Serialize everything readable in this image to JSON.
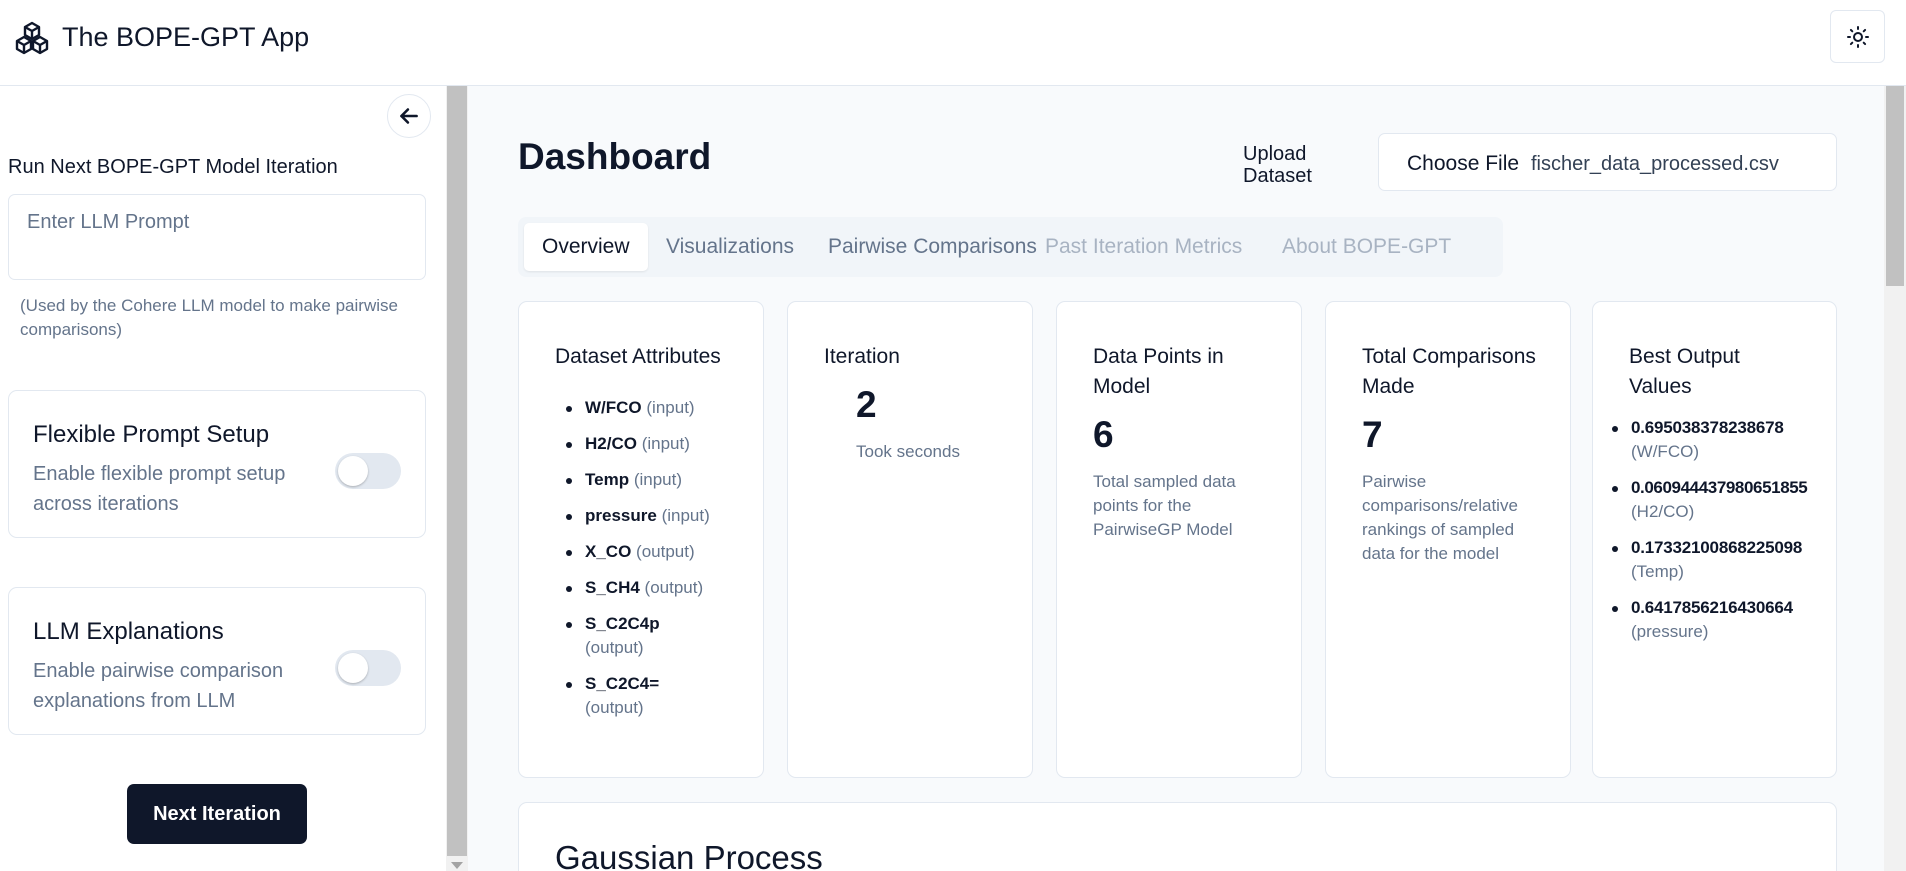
{
  "header": {
    "app_title": "The BOPE-GPT App",
    "logo_icon": "cubes-logo-icon",
    "theme_icon": "sun-icon"
  },
  "sidebar": {
    "collapse_icon": "arrow-left-icon",
    "run_title": "Run Next BOPE-GPT Model Iteration",
    "prompt_placeholder": "Enter LLM Prompt",
    "prompt_value": "",
    "prompt_help": "(Used by the Cohere LLM model to make pairwise comparisons)",
    "toggles": [
      {
        "title": "Flexible Prompt Setup",
        "description": "Enable flexible prompt setup across iterations",
        "enabled": false
      },
      {
        "title": "LLM Explanations",
        "description": "Enable pairwise comparison explanations from LLM",
        "enabled": false
      }
    ],
    "next_button": "Next Iteration"
  },
  "main": {
    "title": "Dashboard",
    "upload_label": "Upload Dataset",
    "choose_file_label": "Choose File",
    "file_name": "fischer_data_processed.csv",
    "tabs": [
      {
        "label": "Overview",
        "state": "active"
      },
      {
        "label": "Visualizations",
        "state": "enabled"
      },
      {
        "label": "Pairwise Comparisons",
        "state": "enabled"
      },
      {
        "label": "Past Iteration Metrics",
        "state": "disabled"
      },
      {
        "label": "About BOPE-GPT",
        "state": "disabled"
      }
    ],
    "cards": {
      "attributes": {
        "title": "Dataset Attributes",
        "items": [
          {
            "name": "W/FCO",
            "type": "(input)"
          },
          {
            "name": "H2/CO",
            "type": "(input)"
          },
          {
            "name": "Temp",
            "type": "(input)"
          },
          {
            "name": "pressure",
            "type": "(input)"
          },
          {
            "name": "X_CO",
            "type": "(output)"
          },
          {
            "name": "S_CH4",
            "type": "(output)"
          },
          {
            "name": "S_C2C4p",
            "type": "(output)"
          },
          {
            "name": "S_C2C4=",
            "type": "(output)"
          }
        ]
      },
      "iteration": {
        "title": "Iteration",
        "value": "2",
        "sub": "Took seconds"
      },
      "data_points": {
        "title": "Data Points in Model",
        "value": "6",
        "sub": "Total sampled data points for the PairwiseGP Model"
      },
      "comparisons": {
        "title": "Total Comparisons Made",
        "value": "7",
        "sub": "Pairwise comparisons/relative rankings of sampled data for the model"
      },
      "best_output": {
        "title": "Best Output Values",
        "items": [
          {
            "value": "0.695038378238678",
            "label": "(W/FCO)"
          },
          {
            "value": "0.060944437980651855",
            "label": "(H2/CO)"
          },
          {
            "value": "0.17332100868225098",
            "label": "(Temp)"
          },
          {
            "value": "0.6417856216430664",
            "label": "(pressure)"
          }
        ]
      }
    },
    "gp_title": "Gaussian Process"
  }
}
